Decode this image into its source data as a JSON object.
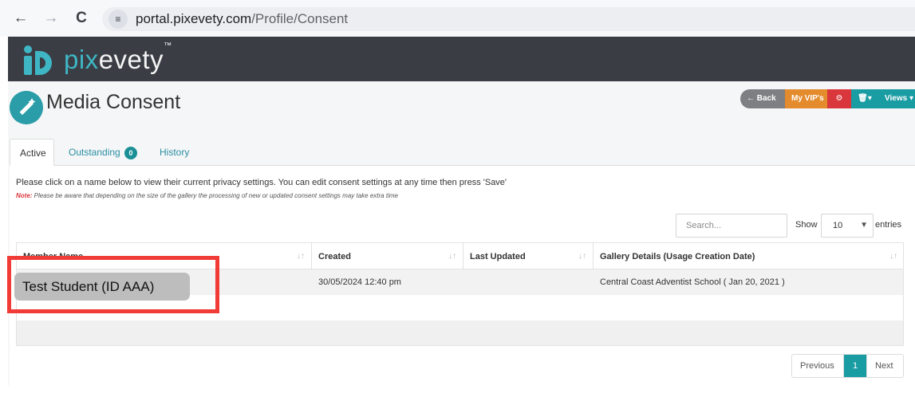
{
  "browser": {
    "back_icon": "←",
    "forward_icon": "→",
    "reload_icon": "C",
    "site_info_icon": "≡",
    "url_host": "portal.pixevety.com",
    "url_path": "/Profile/Consent"
  },
  "brand": {
    "logo_pix": "pix",
    "logo_evety": "evety",
    "trademark": "™",
    "colors": {
      "teal": "#3fb6c4",
      "header": "#3a3d44"
    }
  },
  "page": {
    "title": "Media Consent"
  },
  "toolbar": {
    "back_label": "← Back",
    "my_vips_label": "My VIP's",
    "settings_glyph": "⚙",
    "trash_glyph": "🗑▾",
    "views_label": "Views ▾"
  },
  "tabs": [
    {
      "label": "Active"
    },
    {
      "label": "Outstanding",
      "badge": "0"
    },
    {
      "label": "History"
    }
  ],
  "info": {
    "instructions": "Please click on a name below to view their current privacy settings. You can edit consent settings at any time then press 'Save'",
    "note_label": "Note:",
    "note_text": " Please be aware that depending on the size of the gallery the processing of new or updated consent settings may take extra time"
  },
  "table_controls": {
    "search_placeholder": "Search...",
    "show_label": "Show",
    "page_length": "10",
    "entries_label": "entries"
  },
  "table": {
    "columns": [
      "Member Name",
      "Created",
      "Last Updated",
      "Gallery Details (Usage Creation Date)"
    ],
    "rows": [
      {
        "member_name": "Test Student (ID AAA)",
        "created": "30/05/2024 12:40 pm",
        "last_updated": "",
        "gallery_details": "Central Coast Adventist School ( Jan 20, 2021 )"
      }
    ]
  },
  "pagination": {
    "previous": "Previous",
    "current": "1",
    "next": "Next"
  },
  "annotation": {
    "highlight_color": "#f03b37"
  }
}
